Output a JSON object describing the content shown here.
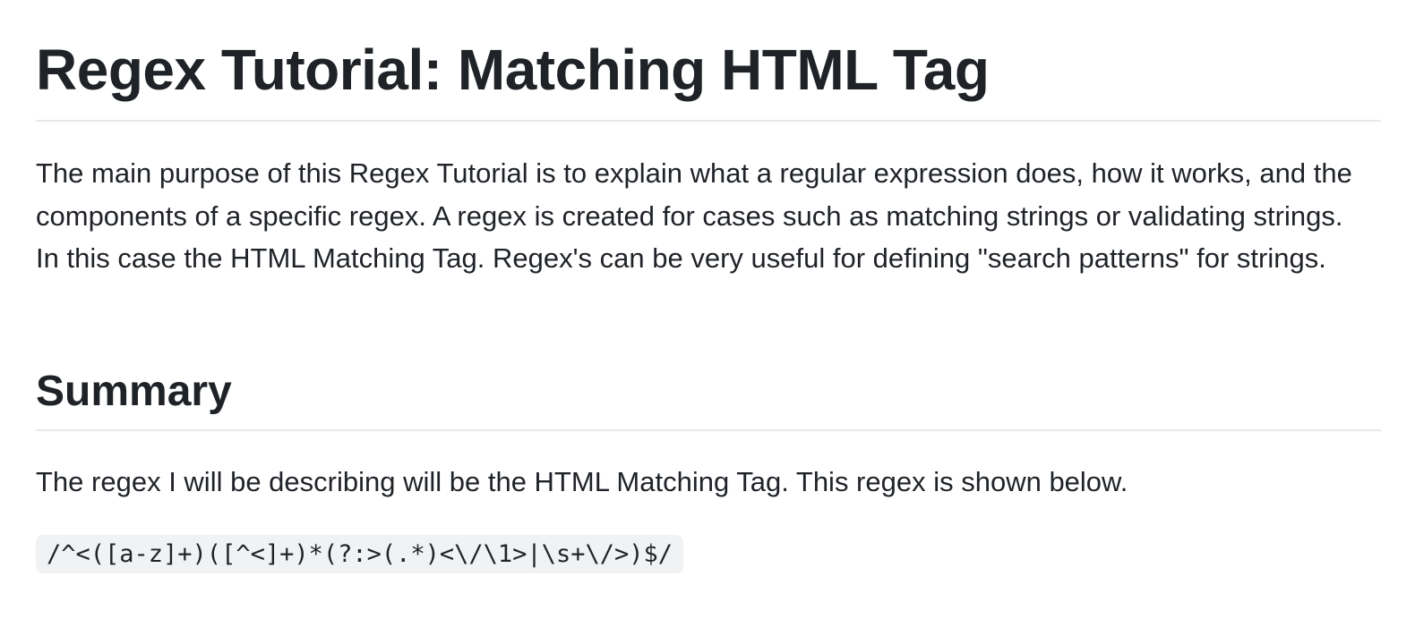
{
  "document": {
    "title": "Regex Tutorial: Matching HTML Tag",
    "intro": "The main purpose of this Regex Tutorial is to explain what a regular expression does, how it works, and the components of a specific regex. A regex is created for cases such as matching strings or validating strings. In this case the HTML Matching Tag. Regex's can be very useful for defining \"search patterns\" for strings.",
    "summary_heading": "Summary",
    "summary_text": "The regex I will be describing will be the HTML Matching Tag. This regex is shown below.",
    "regex_code": "/^<([a-z]+)([^<]+)*(?:>(.*)<\\/\\1>|\\s+\\/>)$/"
  }
}
